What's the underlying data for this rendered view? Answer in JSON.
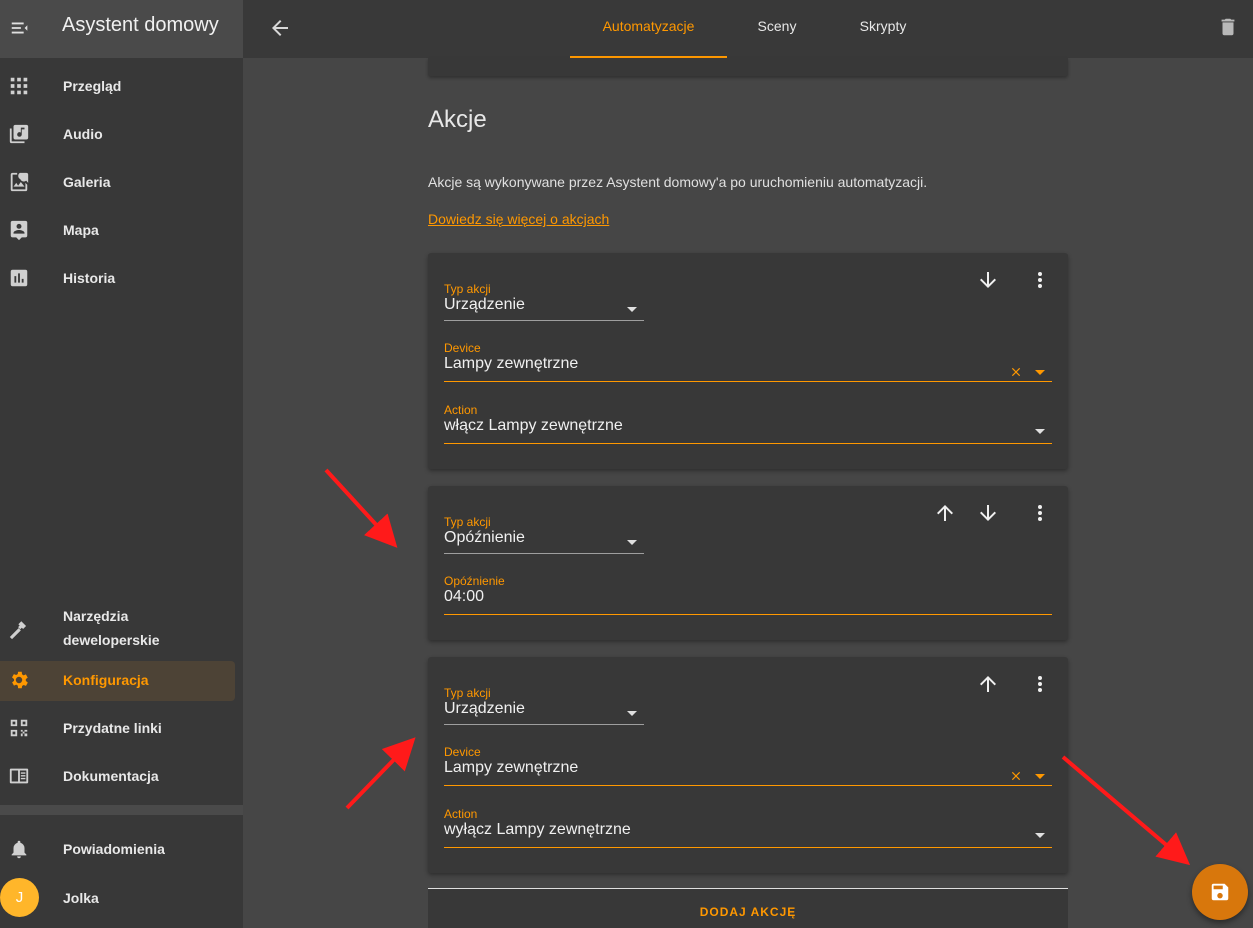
{
  "app": {
    "title": "Asystent domowy"
  },
  "sidebar": {
    "items": [
      {
        "label": "Przegląd",
        "icon": "grid-icon"
      },
      {
        "label": "Audio",
        "icon": "music-library-icon"
      },
      {
        "label": "Galeria",
        "icon": "image-search-icon"
      },
      {
        "label": "Mapa",
        "icon": "map-account-icon"
      },
      {
        "label": "Historia",
        "icon": "chart-bar-icon"
      }
    ],
    "bottom_items": [
      {
        "label": "Narzędzia\ndeweloperskie",
        "icon": "hammer-icon"
      },
      {
        "label": "Konfiguracja",
        "icon": "gear-icon",
        "active": true
      },
      {
        "label": "Przydatne linki",
        "icon": "qrcode-icon"
      },
      {
        "label": "Dokumentacja",
        "icon": "book-icon"
      }
    ],
    "notifications_label": "Powiadomienia",
    "user": {
      "name": "Jolka",
      "initial": "J"
    }
  },
  "topbar": {
    "tabs": [
      "Automatyzacje",
      "Sceny",
      "Skrypty"
    ],
    "active_tab": "Automatyzacje"
  },
  "main": {
    "section_title": "Akcje",
    "description": "Akcje są wykonywane przez Asystent domowy'a po uruchomieniu automatyzacji.",
    "learn_more": "Dowiedz się więcej o akcjach",
    "actions": [
      {
        "type_label": "Typ akcji",
        "type_value": "Urządzenie",
        "device_label": "Device",
        "device_value": "Lampy zewnętrzne",
        "action_label": "Action",
        "action_value": "włącz Lampy zewnętrzne"
      },
      {
        "type_label": "Typ akcji",
        "type_value": "Opóźnienie",
        "delay_label": "Opóźnienie",
        "delay_value": "04:00"
      },
      {
        "type_label": "Typ akcji",
        "type_value": "Urządzenie",
        "device_label": "Device",
        "device_value": "Lampy zewnętrzne",
        "action_label": "Action",
        "action_value": "wyłącz Lampy zewnętrzne"
      }
    ],
    "add_action": "DODAJ AKCJĘ"
  },
  "colors": {
    "accent": "#ff9800",
    "background": "#464646",
    "card": "#383838",
    "annotation_arrow": "#ff1a1a"
  }
}
